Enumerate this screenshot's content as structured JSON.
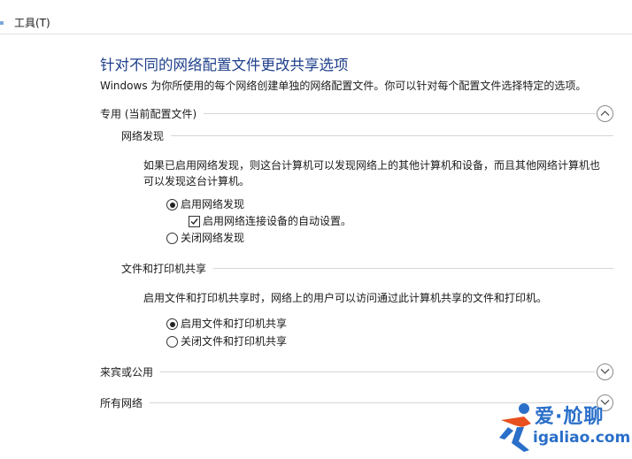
{
  "window": {
    "menu": {
      "tools_label": "工具(T)"
    }
  },
  "page": {
    "title": "针对不同的网络配置文件更改共享选项",
    "description": "Windows 为你所使用的每个网络创建单独的网络配置文件。你可以针对每个配置文件选择特定的选项。"
  },
  "sections": {
    "private": {
      "label": "专用 (当前配置文件)",
      "expanded": true,
      "network_discovery": {
        "heading": "网络发现",
        "text_line1": "如果已启用网络发现，则这台计算机可以发现网络上的其他计算机和设备，而且其他网络计算机也",
        "text_line2": "可以发现这台计算机。",
        "on_label": "启用网络发现",
        "auto_setup_label": "启用网络连接设备的自动设置。",
        "off_label": "关闭网络发现",
        "selected": "on",
        "auto_setup_checked": true
      },
      "file_printer_sharing": {
        "heading": "文件和打印机共享",
        "text": "启用文件和打印机共享时，网络上的用户可以访问通过此计算机共享的文件和打印机。",
        "on_label": "启用文件和打印机共享",
        "off_label": "关闭文件和打印机共享",
        "selected": "on"
      }
    },
    "guest_public": {
      "label": "来宾或公用",
      "expanded": false
    },
    "all_networks": {
      "label": "所有网络",
      "expanded": false
    }
  },
  "watermark": {
    "cn_text": "爱·尬聊",
    "en_text": "igaliao.com"
  },
  "colors": {
    "title": "#1e3f8a",
    "watermark": "#2a6fc9",
    "watermark_accent": "#e8501e"
  },
  "icons": {
    "collapse": "chevron-up-icon",
    "expand": "chevron-down-icon",
    "logo": "running-figure-icon"
  }
}
